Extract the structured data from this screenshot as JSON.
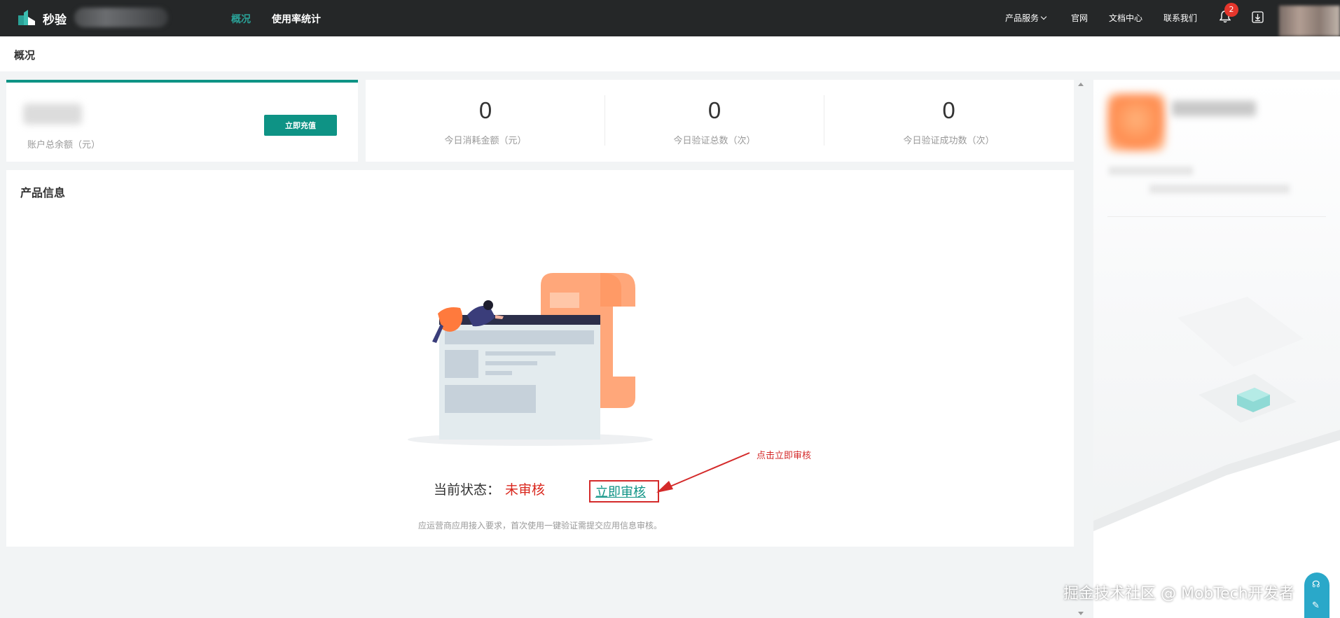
{
  "topbar": {
    "brand": "秒验",
    "nav": [
      {
        "label": "概况",
        "active": true
      },
      {
        "label": "使用率统计",
        "active": false
      }
    ],
    "links": {
      "product_services": "产品服务",
      "official_site": "官网",
      "docs": "文档中心",
      "contact": "联系我们"
    },
    "notifications_count": "2"
  },
  "page": {
    "title": "概况"
  },
  "balance_card": {
    "label": "账户总余额（元）",
    "recharge_button": "立即充值"
  },
  "stats": [
    {
      "value": "0",
      "label": "今日消耗金额（元）"
    },
    {
      "value": "0",
      "label": "今日验证总数（次）"
    },
    {
      "value": "0",
      "label": "今日验证成功数（次）"
    }
  ],
  "product": {
    "title": "产品信息",
    "status_label": "当前状态：",
    "status_value": "未审核",
    "review_link": "立即审核",
    "note": "应运营商应用接入要求，首次使用一键验证需提交应用信息审核。",
    "annotation": "点击立即审核"
  },
  "watermark": "掘金技术社区 @ MobTech开发者",
  "colors": {
    "accent": "#0e9385",
    "nav_active": "#2aa197",
    "topbar_bg": "#252728",
    "status_red": "#d9261c",
    "annotation_red": "#d42a2a"
  },
  "icons": [
    "logo-icon",
    "chevron-down-icon",
    "bell-icon",
    "download-icon",
    "headset-icon",
    "edit-icon"
  ]
}
